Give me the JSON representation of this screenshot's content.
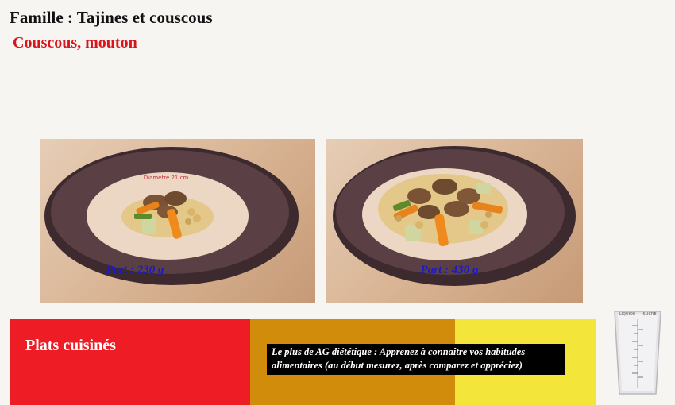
{
  "header": {
    "family": "Famille : Tajines et couscous",
    "dish": "Couscous, mouton"
  },
  "photos": [
    {
      "portion": "Part : 230 g"
    },
    {
      "portion": "Part : 430 g"
    }
  ],
  "plate_rim_text": "Diamètre 21 cm",
  "category": {
    "label": "Plats cuisinés"
  },
  "tip": {
    "text": "Le plus de AG diététique : Apprenez à connaître vos habitudes alimentaires (au début mesurez, après comparez et appréciez)"
  },
  "measuring_cup": {
    "label_left": "LIQUIDE",
    "label_right": "SUCRE",
    "icon": "measuring-cup-icon"
  },
  "colors": {
    "title_red": "#d8141c",
    "portion_blue": "#1a1ac8",
    "band_red": "#ee1d25",
    "band_orange": "#d08c0a",
    "band_yellow": "#f4e53a"
  }
}
